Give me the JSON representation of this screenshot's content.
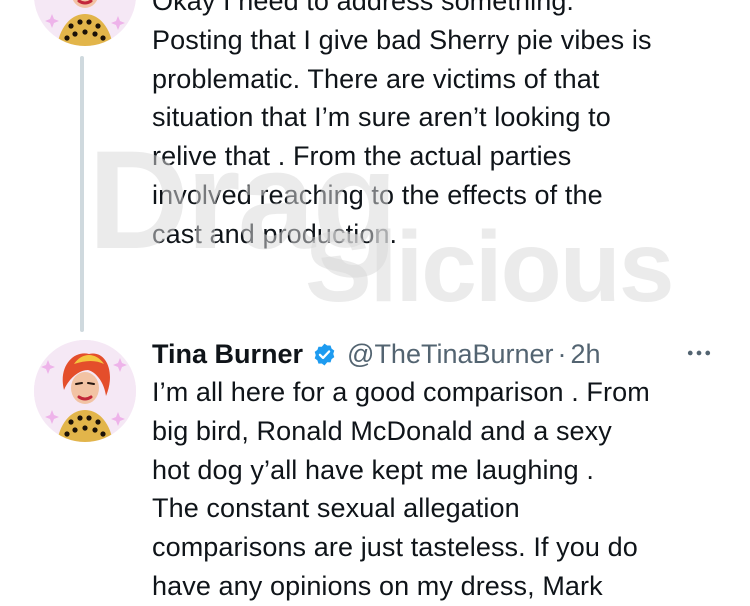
{
  "watermark": {
    "line1": "Drag",
    "line2": "Slicious"
  },
  "tweets": [
    {
      "lines": [
        "Okay I need to address something.",
        "Posting that I give bad Sherry pie vibes is",
        "problematic. There are victims of that",
        "situation that I’m sure aren’t looking to",
        "relive that . From the actual parties",
        "involved reaching to the effects of the",
        "cast and production."
      ]
    },
    {
      "display_name": "Tina Burner",
      "handle": "@TheTinaBurner",
      "separator": "·",
      "time": "2h",
      "lines": [
        "I’m all here for a good comparison . From",
        "big bird, Ronald McDonald and a sexy",
        "hot dog  y’all have kept me laughing .",
        "The constant sexual allegation",
        "comparisons are just tasteless. If you do",
        "have any opinions on my dress, Mark"
      ]
    }
  ],
  "icons": {
    "verified": "verified-badge-icon",
    "more": "more-options-icon",
    "avatar": "profile-avatar"
  },
  "colors": {
    "text": "#0f1419",
    "secondary": "#536471",
    "verified": "#1d9bf0",
    "thread_line": "#cfd9de",
    "watermark": "#e1e1e1"
  }
}
